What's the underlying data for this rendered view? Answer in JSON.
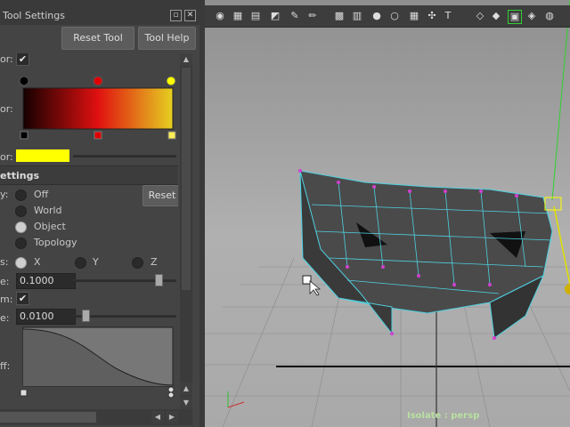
{
  "window": {
    "title": "Tool Settings"
  },
  "buttons": {
    "reset_tool": "Reset Tool",
    "tool_help": "Tool Help",
    "reset": "Reset"
  },
  "settings": {
    "check_label": "or:",
    "color_label": "or:",
    "color_label2": "or:",
    "section_title": "ettings",
    "symmetry_label": "y:",
    "symmetry_options": [
      "Off",
      "World",
      "Object",
      "Topology"
    ],
    "axis_label": "s:",
    "axes": [
      "X",
      "Y",
      "Z"
    ],
    "size_label": "e:",
    "size_value": "0.1000",
    "sym_label": "m:",
    "tolerance_label": "e:",
    "tolerance_value": "0.0100",
    "falloff_label": "ff:"
  },
  "viewport": {
    "status": "Isolate : persp"
  },
  "colors": {
    "ramp_start": "#000000",
    "ramp_mid": "#e00000",
    "ramp_end": "#ffee00",
    "accent": "#ffff00"
  },
  "icons": [
    "select-icon",
    "lasso-icon",
    "paint-icon",
    "move-icon",
    "rotate-icon",
    "scale-icon"
  ]
}
